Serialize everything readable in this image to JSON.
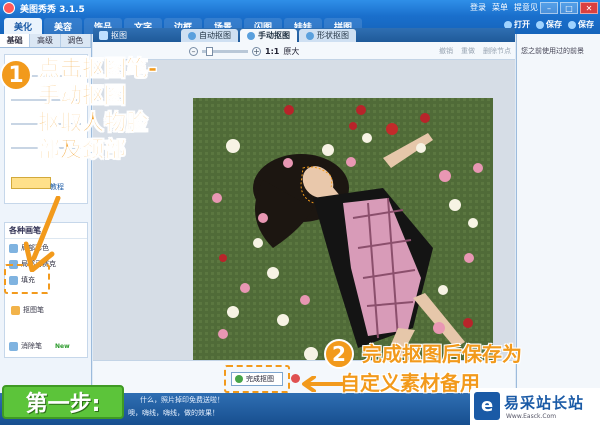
{
  "app": {
    "title": "美图秀秀 3.1.5"
  },
  "titlebar": {
    "login": "登录",
    "menu": "菜单",
    "feedback": "提意见"
  },
  "nav": {
    "tabs": [
      "美化",
      "美容",
      "饰品",
      "文字",
      "边框",
      "场景",
      "闪图",
      "娃娃",
      "拼图"
    ],
    "right": [
      "打开",
      "保存",
      "保存"
    ]
  },
  "left_panel": {
    "tabs": [
      "基础",
      "高级",
      "调色"
    ],
    "tools_heading": "各种画笔",
    "tools": [
      "局部彩色",
      "局部马赛克",
      "填充",
      "抠图笔",
      "消除笔"
    ],
    "new_badge": "New",
    "tutorial_link": "教程"
  },
  "editor": {
    "breadcrumb": "抠图",
    "tabs": [
      "自动抠图",
      "手动抠图",
      "形状抠图"
    ],
    "active_tab": 1,
    "zoom_ratio": "1:1",
    "zoom_original": "原大",
    "actions": [
      "撤销",
      "重做",
      "删除节点"
    ],
    "done_button": "完成抠图"
  },
  "right_panel": {
    "title": "您之前使用过的前景"
  },
  "status": {
    "tip1": "什么，照片掉印免费送啦！",
    "tip2": "噢，嗨线，嗨线，做的效果！"
  },
  "annotations": {
    "step1_number": "1",
    "step1_lines": [
      "点击抠图笔-",
      "手动抠图",
      "抠取人物脸",
      "部及颈部"
    ],
    "step2_number": "2",
    "step2_lines": [
      "完成抠图后保存为",
      "自定义素材备用"
    ],
    "step_badge": "第一步:",
    "watermark_title": "易采站长站",
    "watermark_url": "Www.Easck.Com"
  },
  "colors": {
    "accent_orange": "#f29a1c",
    "badge_green": "#5cc43a",
    "brand_blue": "#1a6fcc"
  }
}
